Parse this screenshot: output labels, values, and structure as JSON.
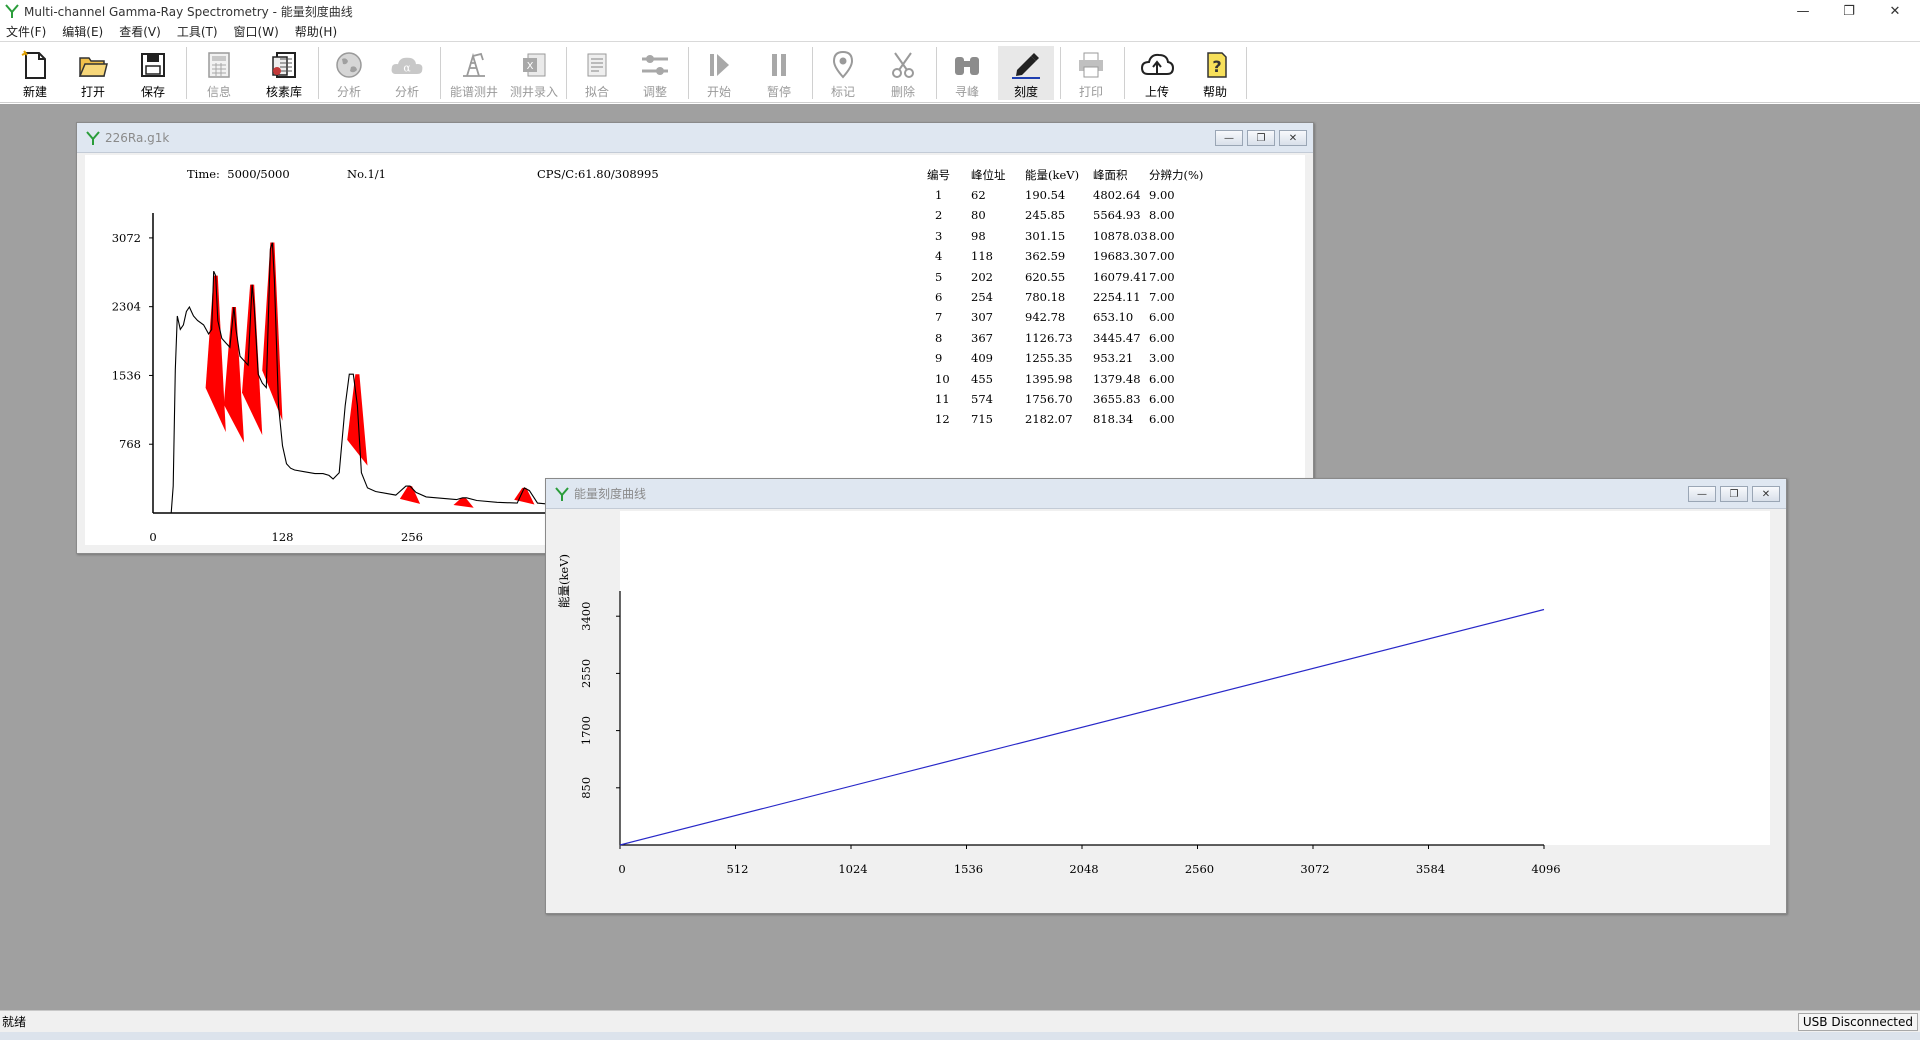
{
  "window": {
    "title": "Multi-channel Gamma-Ray Spectrometry - 能量刻度曲线",
    "minimize_glyph": "—",
    "restore_glyph": "❐",
    "close_glyph": "✕"
  },
  "menu": [
    "文件(F)",
    "编辑(E)",
    "查看(V)",
    "工具(T)",
    "窗口(W)",
    "帮助(H)"
  ],
  "toolbar": {
    "new": "新建",
    "open": "打开",
    "save": "保存",
    "info": "信息",
    "nuclide_lib": "核素库",
    "analyze1": "分析",
    "analyze2": "分析",
    "spectrum_log": "能谱测井",
    "log_entry": "测井录入",
    "fit": "拟合",
    "adjust": "调整",
    "start": "开始",
    "pause": "暂停",
    "mark": "标记",
    "delete": "删除",
    "find_peak": "寻峰",
    "calibrate": "刻度",
    "print": "打印",
    "upload": "上传",
    "help": "帮助"
  },
  "spectrum_window": {
    "title": "226Ra.g1k",
    "time_label": "Time:",
    "time_value": "5000/5000",
    "no_label": "No.1/1",
    "cps_label": "CPS/C:61.80/308995",
    "table_headers": [
      "编号",
      "峰位址",
      "能量(keV)",
      "峰面积",
      "分辨力(%)"
    ],
    "peaks": [
      [
        "1",
        "62",
        "190.54",
        "4802.64",
        "9.00"
      ],
      [
        "2",
        "80",
        "245.85",
        "5564.93",
        "8.00"
      ],
      [
        "3",
        "98",
        "301.15",
        "10878.03",
        "8.00"
      ],
      [
        "4",
        "118",
        "362.59",
        "19683.30",
        "7.00"
      ],
      [
        "5",
        "202",
        "620.55",
        "16079.41",
        "7.00"
      ],
      [
        "6",
        "254",
        "780.18",
        "2254.11",
        "7.00"
      ],
      [
        "7",
        "307",
        "942.78",
        "653.10",
        "6.00"
      ],
      [
        "8",
        "367",
        "1126.73",
        "3445.47",
        "6.00"
      ],
      [
        "9",
        "409",
        "1255.35",
        "953.21",
        "3.00"
      ],
      [
        "10",
        "455",
        "1395.98",
        "1379.48",
        "6.00"
      ],
      [
        "11",
        "574",
        "1756.70",
        "3655.83",
        "6.00"
      ],
      [
        "12",
        "715",
        "2182.07",
        "818.34",
        "6.00"
      ]
    ]
  },
  "calibration_window": {
    "title": "能量刻度曲线"
  },
  "chart_data": [
    {
      "type": "area",
      "title": "",
      "xlabel": "",
      "ylabel": "",
      "x_ticks": [
        "0",
        "128",
        "256"
      ],
      "y_ticks": [
        "3072",
        "2304",
        "1536",
        "768"
      ],
      "xlim": [
        0,
        1024
      ],
      "ylim": [
        0,
        3350
      ],
      "spectrum_points": [
        [
          0,
          0
        ],
        [
          10,
          0
        ],
        [
          18,
          0
        ],
        [
          20,
          300
        ],
        [
          22,
          1600
        ],
        [
          24,
          2200
        ],
        [
          25,
          2150
        ],
        [
          27,
          2050
        ],
        [
          30,
          2100
        ],
        [
          33,
          2250
        ],
        [
          36,
          2300
        ],
        [
          38,
          2250
        ],
        [
          40,
          2200
        ],
        [
          44,
          2150
        ],
        [
          50,
          2100
        ],
        [
          55,
          2000
        ],
        [
          58,
          2050
        ],
        [
          60,
          2700
        ],
        [
          62,
          2650
        ],
        [
          64,
          2150
        ],
        [
          68,
          1950
        ],
        [
          72,
          1900
        ],
        [
          76,
          1850
        ],
        [
          80,
          2300
        ],
        [
          82,
          2050
        ],
        [
          86,
          1750
        ],
        [
          90,
          1700
        ],
        [
          94,
          1650
        ],
        [
          98,
          2550
        ],
        [
          100,
          2300
        ],
        [
          104,
          1550
        ],
        [
          108,
          1450
        ],
        [
          112,
          1400
        ],
        [
          116,
          2950
        ],
        [
          118,
          3020
        ],
        [
          120,
          2600
        ],
        [
          124,
          1200
        ],
        [
          128,
          750
        ],
        [
          132,
          550
        ],
        [
          136,
          500
        ],
        [
          140,
          480
        ],
        [
          150,
          460
        ],
        [
          160,
          440
        ],
        [
          168,
          440
        ],
        [
          174,
          420
        ],
        [
          178,
          380
        ],
        [
          184,
          450
        ],
        [
          190,
          1200
        ],
        [
          194,
          1550
        ],
        [
          198,
          1550
        ],
        [
          202,
          1200
        ],
        [
          206,
          450
        ],
        [
          212,
          280
        ],
        [
          220,
          240
        ],
        [
          230,
          220
        ],
        [
          240,
          200
        ],
        [
          250,
          300
        ],
        [
          254,
          300
        ],
        [
          260,
          230
        ],
        [
          270,
          180
        ],
        [
          290,
          160
        ],
        [
          300,
          150
        ],
        [
          306,
          170
        ],
        [
          310,
          170
        ],
        [
          320,
          140
        ],
        [
          340,
          120
        ],
        [
          360,
          110
        ],
        [
          367,
          280
        ],
        [
          372,
          250
        ],
        [
          380,
          110
        ],
        [
          400,
          90
        ],
        [
          409,
          130
        ],
        [
          420,
          90
        ],
        [
          440,
          80
        ],
        [
          455,
          120
        ],
        [
          470,
          70
        ],
        [
          500,
          60
        ],
        [
          540,
          50
        ],
        [
          560,
          45
        ],
        [
          574,
          200
        ],
        [
          590,
          120
        ],
        [
          610,
          40
        ],
        [
          650,
          35
        ],
        [
          700,
          30
        ],
        [
          715,
          55
        ],
        [
          730,
          25
        ]
      ],
      "peak_fills": [
        {
          "channel": 62,
          "height": 2650
        },
        {
          "channel": 80,
          "height": 2300
        },
        {
          "channel": 98,
          "height": 2550
        },
        {
          "channel": 118,
          "height": 3020
        },
        {
          "channel": 202,
          "height": 1550
        },
        {
          "channel": 254,
          "height": 300
        },
        {
          "channel": 307,
          "height": 170
        },
        {
          "channel": 367,
          "height": 280
        },
        {
          "channel": 409,
          "height": 130
        },
        {
          "channel": 455,
          "height": 120
        },
        {
          "channel": 574,
          "height": 200
        },
        {
          "channel": 715,
          "height": 55
        }
      ],
      "line_color": "#000000",
      "peak_color": "#ff0000"
    },
    {
      "type": "line",
      "title": "",
      "xlabel": "",
      "ylabel": "能量(keV)",
      "x_ticks": [
        "0",
        "512",
        "1024",
        "1536",
        "2048",
        "2560",
        "3072",
        "3584",
        "4096"
      ],
      "y_ticks": [
        "850",
        "1700",
        "2550",
        "3400"
      ],
      "xlim": [
        0,
        4096
      ],
      "ylim": [
        0,
        4250
      ],
      "series": [
        {
          "points": [
            [
              0,
              0
            ],
            [
              4096,
              3500
            ]
          ],
          "color": "#2828c8"
        }
      ]
    }
  ],
  "statusbar": {
    "left": "就绪",
    "right": "USB Disconnected"
  }
}
